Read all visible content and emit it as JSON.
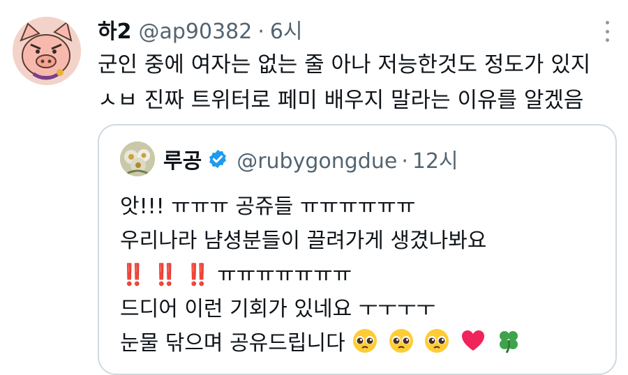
{
  "tweet": {
    "author_name": "하2",
    "handle": "@ap90382",
    "separator": "·",
    "time": "6시",
    "lines": [
      "군인 중에 여자는 없는 줄 아나 저능한것도 정도가 있지",
      "ㅅㅂ 진짜 트위터로 페미 배우지 말라는 이유를 알겠음"
    ]
  },
  "quote": {
    "author_name": "루공",
    "handle": "@rubygongdue",
    "separator": "·",
    "time": "12시",
    "lines": [
      "앗!!! ㅠㅠㅠ 공쥬들 ㅠㅠㅠㅠㅠㅠ",
      "우리나라 냠셩분들이 끌려가게 생겼나봐요",
      "ㅠㅠㅠㅠㅠㅠㅠ",
      "드디어 이런 기회가 있네요 ㅜㅜㅜㅜ",
      "눈물 닦으며 공유드립니다"
    ],
    "line3_emojis": [
      "‼️",
      "‼️",
      "‼️"
    ],
    "line5_emojis": [
      "pleading-face",
      "pleading-face",
      "pleading-face",
      "red-heart",
      "four-leaf-clover"
    ]
  },
  "icons": {
    "more": "more-options-icon",
    "verified": "verified-badge-icon"
  },
  "colors": {
    "text": "#0f1419",
    "secondary": "#536471",
    "border": "#cfd9de",
    "verified": "#1d9bf0"
  }
}
